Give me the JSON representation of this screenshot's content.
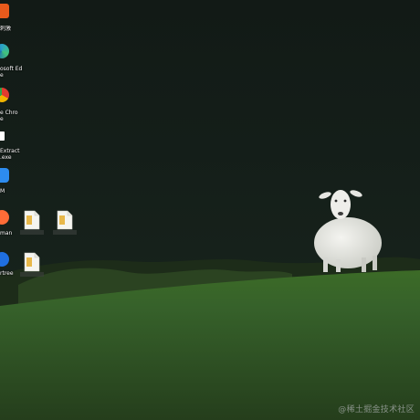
{
  "desktop": {
    "icons": [
      {
        "label": "刺激",
        "icon": "media-app-icon",
        "color": "#e85a1c"
      },
      {
        "label": "osoft Ed\ne",
        "icon": "edge-icon",
        "color": "#2aa0c8"
      },
      {
        "label": "e Chro\ne",
        "icon": "chrome-icon",
        "color": "#f0b400"
      },
      {
        "label": "Extract\n.exe",
        "icon": "extractor-icon",
        "color": "#ffffff"
      },
      {
        "label": "M",
        "icon": "chat-app-icon",
        "color": "#2d8cf0"
      },
      {
        "label": "man",
        "icon": "postman-icon",
        "color": "#ff6c37"
      },
      {
        "label": "rtree",
        "icon": "sourcetree-icon",
        "color": "#1f6fe0"
      }
    ],
    "files": [
      {
        "label": "",
        "icon": "document-file-icon"
      },
      {
        "label": "",
        "icon": "document-file-icon"
      },
      {
        "label": "",
        "icon": "document-file-icon"
      }
    ]
  },
  "watermark": "@稀土掘金技术社区"
}
